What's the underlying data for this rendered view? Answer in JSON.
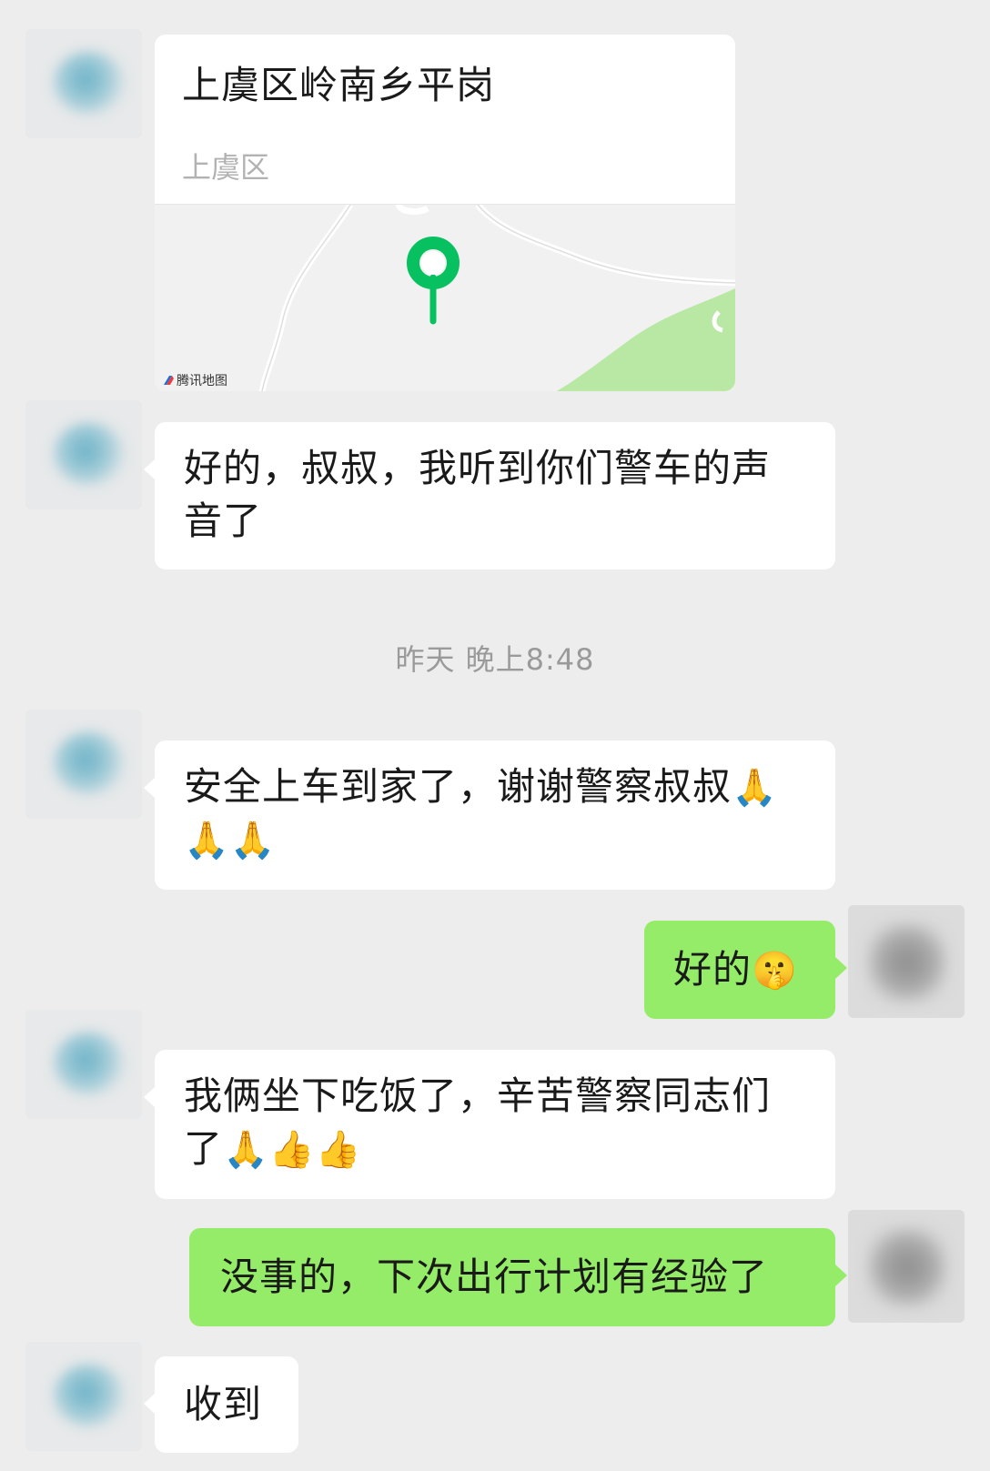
{
  "location": {
    "title": "上虞区岭南乡平岗",
    "subtitle": "上虞区",
    "map_credit": "腾讯地图",
    "pin_color": "#07c160",
    "green_area_color": "#b8e8a4"
  },
  "messages": [
    {
      "side": "in",
      "text": "好的，叔叔，我听到你们警车的声音了"
    },
    {
      "side": "in",
      "text": "安全上车到家了，谢谢警察叔叔🙏🙏🙏"
    },
    {
      "side": "out",
      "text": "好的🤫"
    },
    {
      "side": "in",
      "text": "我俩坐下吃饭了，辛苦警察同志们了🙏👍👍"
    },
    {
      "side": "out",
      "text": "没事的，下次出行计划有经验了"
    },
    {
      "side": "in",
      "text": "收到"
    }
  ],
  "msg": {
    "m1_line1": "好的，叔叔，我听到你们警车的声",
    "m1_line2": "音了",
    "m2_line1": "安全上车到家了，谢谢警察叔叔",
    "m2_emoji1": "🙏",
    "m2_emoji2": "🙏🙏",
    "m3_text": "好的",
    "m3_emoji": "🤫",
    "m4_line1": "我俩坐下吃饭了，辛苦警察同志们",
    "m4_line2": "了",
    "m4_emoji": "🙏👍👍",
    "m5_text": "没事的，下次出行计划有经验了",
    "m6_text": "收到"
  },
  "timestamp": "昨天 晚上8:48",
  "colors": {
    "background": "#ededed",
    "incoming_bubble": "#ffffff",
    "outgoing_bubble": "#95ec69",
    "timestamp_text": "#9a9a9a"
  }
}
